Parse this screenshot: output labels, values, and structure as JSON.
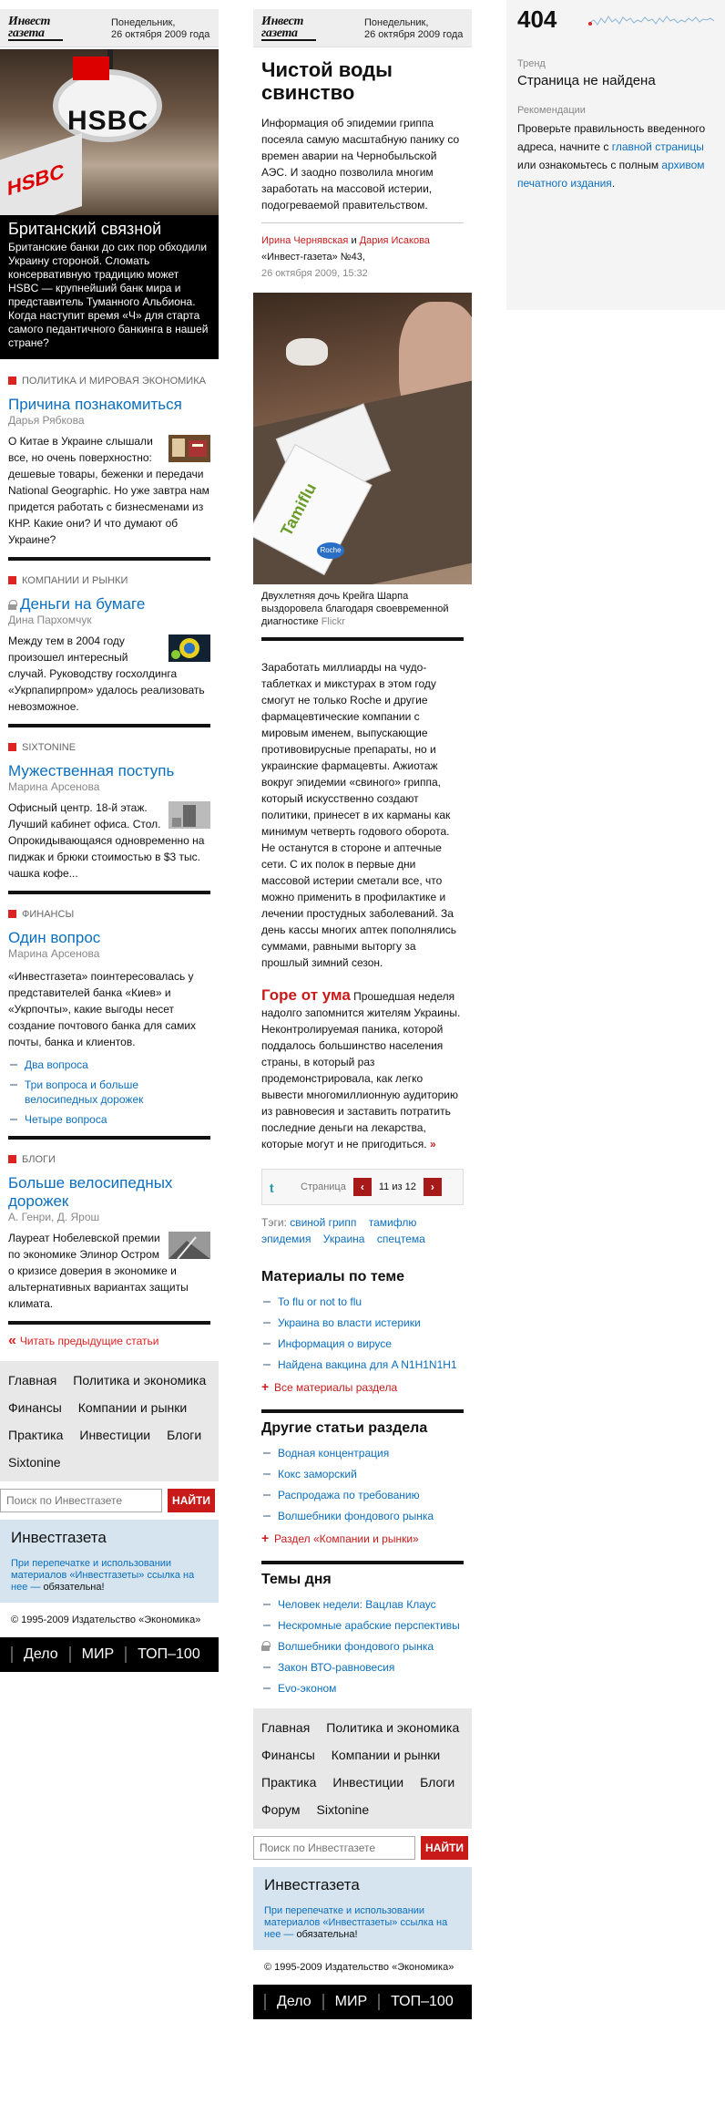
{
  "masthead": {
    "logo_line1": "Инвест",
    "logo_line2": "газета",
    "date_line1": "Понедельник,",
    "date_line2": "26 октября 2009 года"
  },
  "column_a": {
    "lead": {
      "title": "Британский связной",
      "text": "Британские банки до сих пор обходили Украину стороной. Сломать консервативную традицию может HSBC — крупнейший банк мира и представитель Туманного Альбиона. Когда наступит время «Ч» для старта самого педантичного банкинга в нашей стране?",
      "photo_sign_text": "HSBC"
    },
    "sections": [
      {
        "rubric": "Политика и мировая экономика",
        "title": "Причина познакомиться",
        "author": "Дарья Рябкова",
        "text": "О Китае в Украине слышали все, но очень поверхностно: дешевые товары, беженки и передачи National Geographic. Но уже завтра нам придется работать с бизнесменами из КНР. Какие они? И что думают об Украине?",
        "locked": false,
        "links": []
      },
      {
        "rubric": "Компании и рынки",
        "title": "Деньги на бумаге",
        "author": "Дина Пархомчук",
        "text": "Между тем в 2004 году произошел интересный случай. Руководству госхолдинга «Укрпапирпром» удалось реализовать невозможное.",
        "locked": true,
        "links": []
      },
      {
        "rubric": "Sixtonine",
        "title": "Мужественная поступь",
        "author": "Марина Арсенова",
        "text": "Офисный центр. 18-й этаж. Лучший кабинет офиса. Стол. Опрокидывающаяся одновременно на пиджак и брюки стоимостью в $3 тыс. чашка кофе...",
        "locked": false,
        "links": []
      },
      {
        "rubric": "Финансы",
        "title": "Один вопрос",
        "author": "Марина Арсенова",
        "text": "«Инвестгазета» поинтересовалась у представителей банка «Киев» и «Укрпочты», какие выгоды несет создание почтового банка для самих почты, банка и клиентов.",
        "locked": false,
        "links": [
          "Два вопроса",
          "Три вопроса и больше велосипедных дорожек",
          "Четыре вопроса"
        ]
      },
      {
        "rubric": "Блоги",
        "title": "Больше велосипедных дорожек",
        "author": "А. Генри, Д. Ярош",
        "text": "Лауреат Нобелевской премии по экономике Элинор Остром о кризисе доверия в экономике и альтернативных вариантах защиты климата.",
        "locked": false,
        "links": []
      }
    ],
    "prev_link": "Читать предыдущие статьи",
    "nav_rows": [
      [
        "Главная",
        "Политика и экономика"
      ],
      [
        "Финансы",
        "Компании и рынки"
      ],
      [
        "Практика",
        "Инвестиции",
        "Блоги"
      ],
      [
        "Sixtonine"
      ]
    ]
  },
  "column_b": {
    "title": "Чистой воды свинство",
    "summary": "Информация об эпидемии гриппа посеяла самую масштабную панику со времен аварии на Чернобыльской АЭС. И заодно позволила многим заработать на массовой истерии, подогреваемой правительством.",
    "author1": "Ирина Чернявская",
    "and": "и",
    "author2": "Дария Исакова",
    "issue": "«Инвест-газета» №43,",
    "pubdate": "26 октября 2009, 15:32",
    "photo_box_text": "Tamiflu",
    "photo_logo_text": "Roche",
    "caption": "Двухлетняя дочь Крейга Шарпа выздоровела благодаря своевременной диагностике",
    "caption_source": "Flickr",
    "body_para1": "Заработать миллиарды на чудо-таблетках и микстурах в этом году смогут не только Roche и другие фармацевтические компании с мировым именем, выпускающие противовирусные препараты, но и украинские фармацевты. Ажиотаж вокруг эпидемии «свиного» гриппа, который искусственно создают политики, принесет в их карманы как минимум четверть годового оборота. Не останутся в стороне и аптечные сети. С их полок в первые дни массовой истерии сметали все, что можно применить в профилактике и лечении простудных заболеваний. За день кассы многих аптек пополнялись суммами, равными выторгу за прошлый зимний сезон.",
    "body_headline": "Горе от ума",
    "body_para2": "Прошедшая неделя надолго запомнится жителям Украины. Неконтролируемая паника, которой поддалось большинство населения страны, в который раз продемонстрировала, как легко вывести многомиллионную аудиторию из равновесия и заставить потратить последние деньги на лекарства, которые могут и не пригодиться.",
    "more_arrow": "»",
    "pager": {
      "label": "Страница",
      "current": "11 из 12",
      "prev": "‹",
      "next": "›"
    },
    "tags_label": "Тэги:",
    "tags": [
      "свиной грипп",
      "тамифлю",
      "эпидемия",
      "Украина",
      "спецтема"
    ],
    "materials": {
      "heading": "Материалы по теме",
      "items": [
        "To flu or not to flu",
        "Украина во власти истерики",
        "Информация о вирусе",
        "Найдена вакцина для A N1H1N1H1"
      ],
      "all_link": "Все материалы раздела"
    },
    "other": {
      "heading": "Другие статьи раздела",
      "items": [
        "Водная концентрация",
        "Кокс заморский",
        "Распродажа по требованию",
        "Волшебники фондового рынка"
      ],
      "section_link": "Раздел «Компании и рынки»"
    },
    "topics": {
      "heading": "Темы дня",
      "items": [
        {
          "text": "Человек недели: Вацлав Клаус",
          "locked": false
        },
        {
          "text": "Нескромные арабские перспективы",
          "locked": false
        },
        {
          "text": "Волшебники фондового рынка",
          "locked": true
        },
        {
          "text": "Закон ВТО-равновесия",
          "locked": false
        },
        {
          "text": "Evo-эконом",
          "locked": false
        }
      ]
    },
    "nav_rows": [
      [
        "Главная",
        "Политика и экономика"
      ],
      [
        "Финансы",
        "Компании и рынки"
      ],
      [
        "Практика",
        "Инвестиции",
        "Блоги"
      ],
      [
        "Форум",
        "Sixtonine"
      ]
    ]
  },
  "common": {
    "search_placeholder": "Поиск по Инвестгазете",
    "search_button": "НАЙТИ",
    "info_title": "Инвестгазета",
    "info_note": "При перепечатке и использовании материалов «Инвестгазеты» ссылка на нее —",
    "info_note_bold": "обязательна!",
    "copyright": "© 1995-2009 Издательство «Экономика»",
    "footer_links": [
      "Дело",
      "МИР",
      "ТОП–100"
    ]
  },
  "column_c": {
    "code": "404",
    "trend_label": "Тренд",
    "trend_value": "Страница не найдена",
    "rec_label": "Рекомендации",
    "rec_text1": "Проверьте правильность введенного адреса, начните с",
    "rec_link1": "главной страницы",
    "rec_text2": "или ознакомьтесь с полным",
    "rec_link2": "архивом печатного издания",
    "rec_end": "."
  },
  "colors": {
    "accent_red": "#c91a1a",
    "link_blue": "#0b6fbf"
  }
}
